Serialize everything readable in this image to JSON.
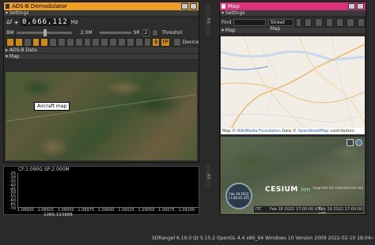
{
  "left_window": {
    "title": "ADS-B Demodulator",
    "settings_label": "Settings",
    "delta_f_label": "Δf",
    "freq_sign": "+",
    "freq_digits": "0,666,112",
    "freq_unit": "Hz",
    "bw_label": "BW",
    "bw_value": "2.0M",
    "sr_label": "SR",
    "sr_value": "2",
    "threshold_label": "Threshol",
    "b_label": "B",
    "fp_label": "FP",
    "device_label": "Device",
    "adsb_data_label": "ADS-B Data",
    "map_label": "Map",
    "tooltip": "Aircraft map"
  },
  "spectrum": {
    "header": "CF:1.090G SP:2.000M",
    "y_ticks": [
      "-25",
      "-30",
      "-35",
      "-40",
      "-45",
      "-50",
      "-55",
      "-60",
      "-65",
      "-70"
    ],
    "x_ticks": [
      "1.08900",
      "1.08925",
      "1.08950",
      "1.08975",
      "1.09000",
      "1.09025",
      "1.09050",
      "1.09075",
      "1.09100"
    ],
    "cursor_value": "1089.333888"
  },
  "right_window": {
    "title": "Map",
    "settings_label": "Settings",
    "find_label": "Find",
    "map_type": "Street Map",
    "map_label": "Map",
    "attribution_prefix": "Map ©",
    "attribution_wiki": "WikiMedia Foundation",
    "attribution_mid": "Data ©",
    "attribution_osm": "OpenStreetMap",
    "attribution_suffix": "contributors",
    "cesium_label": "CESIUM",
    "cesium_ion": "ion",
    "cesium_upgrade": "Upgrade for commercial use",
    "cesium_date1": "Feb 18 2022 17:00:00 UTC",
    "cesium_date2": "Feb 19 2022 17:00:00 UTC",
    "cesium_clock_date": "Feb 18 2022",
    "cesium_clock_time": "17:06:45 UTC",
    "cesium_itc": "ITC"
  },
  "vtab_left": "RX",
  "vtab_right": "RX",
  "status_bar": "SDRangel 6.19.0 Qt 5.15.2 OpenGL 4.4 x86_64 Windows 10 Version 2009  2022-02-10 18:04:47 Paris_Madrid"
}
